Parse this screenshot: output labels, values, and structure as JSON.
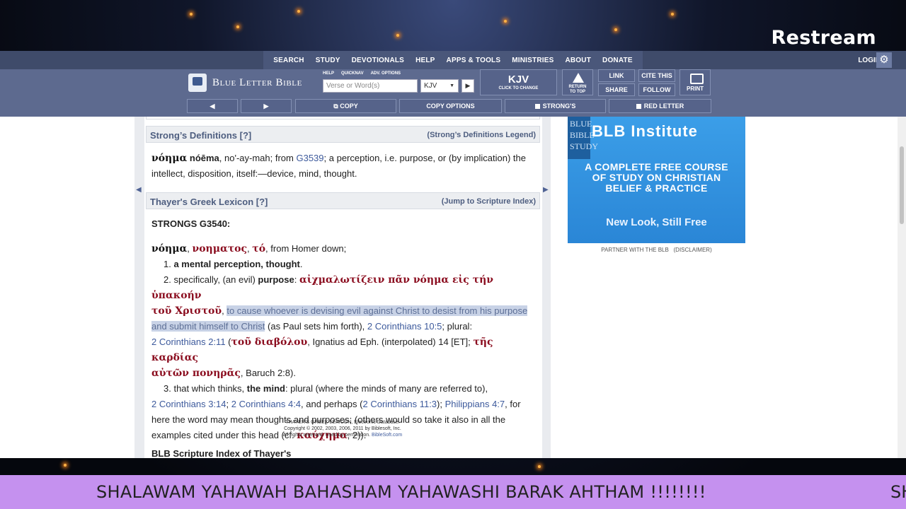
{
  "brand": "Restream",
  "nav": {
    "items": [
      "SEARCH",
      "STUDY",
      "DEVOTIONALS",
      "HELP",
      "APPS & TOOLS",
      "MINISTRIES",
      "ABOUT",
      "DONATE"
    ],
    "login": "LOGIN",
    "gear": "⚙"
  },
  "toolbar": {
    "logo_title": "Blue Letter Bible",
    "sublinks": [
      "HELP",
      "QUICKNAV",
      "ADV. OPTIONS"
    ],
    "verse_placeholder": "Verse or Word(s)",
    "version": "KJV",
    "kjv_big": "KJV",
    "kjv_small": "CLICK TO CHANGE",
    "return_label_1": "RETURN",
    "return_label_2": "TO TOP",
    "link": "LINK",
    "share": "SHARE",
    "cite": "CITE THIS",
    "follow": "FOLLOW",
    "print": "PRINT",
    "prev": "◀",
    "next": "▶",
    "copy": "COPY",
    "copy_options": "COPY OPTIONS",
    "strongs": "STRONG'S",
    "red_letter": "RED LETTER"
  },
  "strongs_def": {
    "header": "Strong’s Definitions [?]",
    "legend": "(Strong’s Definitions Legend)",
    "word": "νόημα",
    "translit": "nóēma",
    "line1_rest": ", no'-ay-mah; from ",
    "ref": "G3539",
    "line1_end": "; a perception, i.e. purpose, or (by implication) the",
    "line2": "intellect, disposition, itself:—device, mind, thought."
  },
  "thayer": {
    "header": "Thayer's Greek Lexicon [?]",
    "jump": "(Jump to Scripture Index)",
    "strongs_no": "STRONGS G3540:",
    "l1_word": "νόημα",
    "l1_gen": "νοηματος",
    "l1_art": "τό",
    "l1_rest": ", from Homer down;",
    "l2_num": "1. ",
    "l2_bold": "a mental perception, thought",
    "l3_a": "2. specifically, (an evil) ",
    "l3_bold": "purpose",
    "l3_greek": "αἰχμαλωτίζειν πᾶν νόημα εἰς τήν ὑπακοήν",
    "l4_greek": "τοῦ Χριστοῦ",
    "l4_hl": "to cause whoever is devising evil against Christ to desist from his purpose",
    "l5_hl": "and submit himself to Christ",
    "l5_rest": " (as Paul sets him forth), ",
    "l5_ref": "2 Corinthians 10:5",
    "l5_end": "; plural:",
    "l6_ref": "2 Corinthians 2:11",
    "l6_greek1": "τοῦ διαβόλου",
    "l6_mid": ", Ignatius ad Eph. (interpolated) 14 [ET]; ",
    "l6_greek2": "τῆς καρδίας",
    "l7_greek": "αὐτῶν πονηρᾶς",
    "l7_rest": ", Baruch 2:8).",
    "l8_a": "3. that which thinks, ",
    "l8_bold": "the mind",
    "l8_rest": ": plural (where the minds of many are referred to),",
    "l9_ref1": "2 Corinthians 3:14",
    "l9_ref2": "2 Corinthians 4:4",
    "l9_mid": ", and perhaps (",
    "l9_ref3": "2 Corinthians 11:3",
    "l9_ref4": "Philippians 4:7",
    "l9_end": ", for",
    "l10": "here the word may mean thoughts and purposes; (others would so take it also in all the",
    "l11_a": "examples cited under this head (cf. ",
    "l11_greek": "καύχημα",
    "l11_end": ", 2)).",
    "copy1": "THAYER'S GREEK LEXICON, Electronic Database.",
    "copy2": "Copyright © 2002, 2003, 2006, 2011 by Biblesoft, Inc.",
    "copy3": "All rights reserved. Used by permission. ",
    "copy3_link": "BibleSoft.com",
    "index_head": "BLB Scripture Index of Thayer's"
  },
  "ad": {
    "edge": "BLUE BIBLE STUDY",
    "heading": "BLB Institute",
    "body": "A COMPLETE FREE COURSE OF STUDY ON CHRISTIAN BELIEF & PRACTICE",
    "footer": "New Look, Still Free",
    "partner": "PARTNER WITH THE BLB",
    "disclaimer": "(DISCLAIMER)"
  },
  "ticker": {
    "message": "SHALAWAM YAHAWAH BAHASHAM YAHAWASHI BARAK AHTHAM !!!!!!!!",
    "next_start": "SH"
  }
}
